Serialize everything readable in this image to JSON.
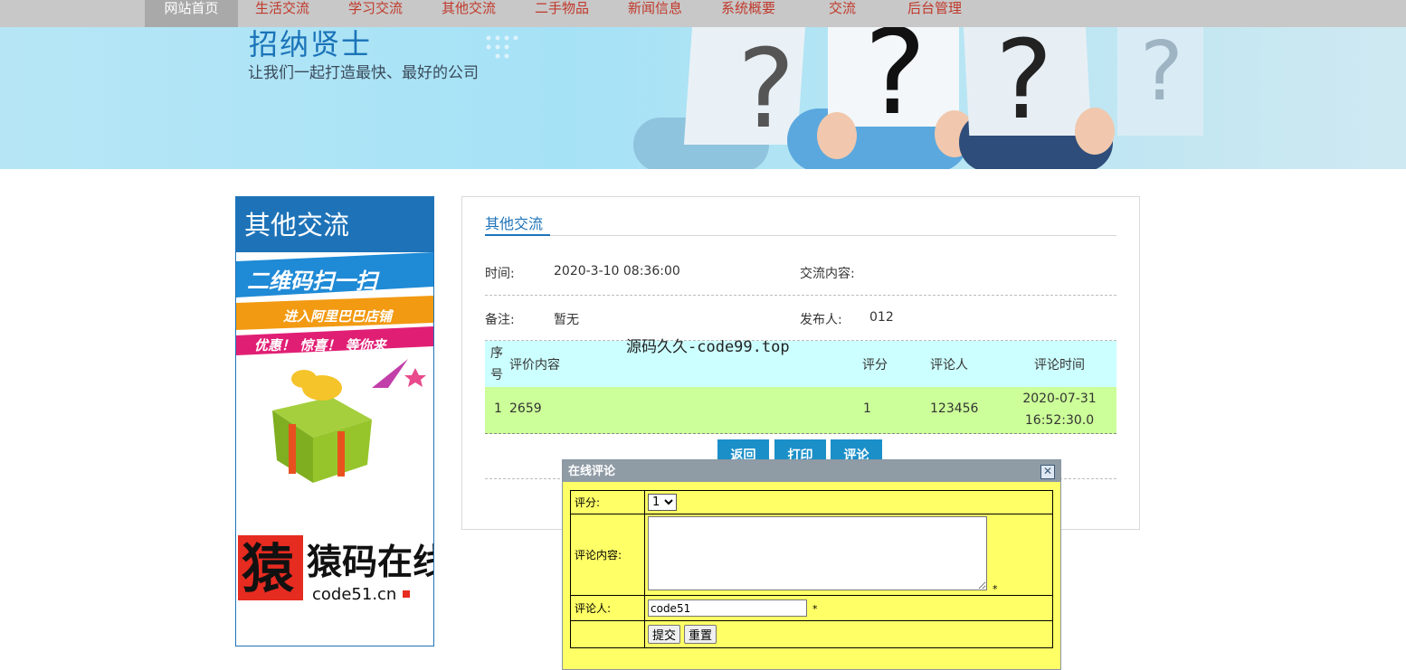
{
  "nav": {
    "items": [
      "网站首页",
      "生活交流",
      "学习交流",
      "其他交流",
      "二手物品",
      "新闻信息",
      "系统概要",
      "交流",
      "后台管理"
    ],
    "active_index": 0
  },
  "banner": {
    "title": "招纳贤士",
    "subtitle": "让我们一起打造最快、最好的公司"
  },
  "sidebar": {
    "title": "其他交流",
    "ad": {
      "line1": "二维码扫一扫",
      "line2": "进入阿里巴巴店铺",
      "line3": "优惠！ 惊喜！ 等你来",
      "logo_text": "猿码在线",
      "logo_url": "code51.cn"
    }
  },
  "detail": {
    "section_title": "其他交流",
    "time_label": "时间:",
    "time_value": "2020-3-10 08:36:00",
    "content_label": "交流内容:",
    "content_value": "",
    "remark_label": "备注:",
    "remark_value": "暂无",
    "publisher_label": "发布人:",
    "publisher_value": "012"
  },
  "comments_table": {
    "headers": {
      "index": "序号",
      "content": "评价内容",
      "score": "评分",
      "author": "评论人",
      "time": "评论时间"
    },
    "rows": [
      {
        "index": "1",
        "content": "2659",
        "score": "1",
        "author": "123456",
        "time": "2020-07-31 16:52:30.0"
      }
    ]
  },
  "buttons": {
    "back": "返回",
    "print": "打印",
    "comment": "评论"
  },
  "watermark": "源码久久-code99.top",
  "dialog": {
    "title": "在线评论",
    "close_symbol": "✕",
    "score_label": "评分:",
    "score_value": "1",
    "score_options": [
      "1"
    ],
    "content_label": "评论内容:",
    "content_value": "",
    "required_mark": "*",
    "person_label": "评论人:",
    "person_value": "code51",
    "submit": "提交",
    "reset": "重置"
  },
  "colors": {
    "accent_blue": "#1e73b8",
    "nav_text": "#c0392b",
    "table_head": "#ccffff",
    "table_row": "#ccff99",
    "dialog_bg": "#ffff66"
  }
}
